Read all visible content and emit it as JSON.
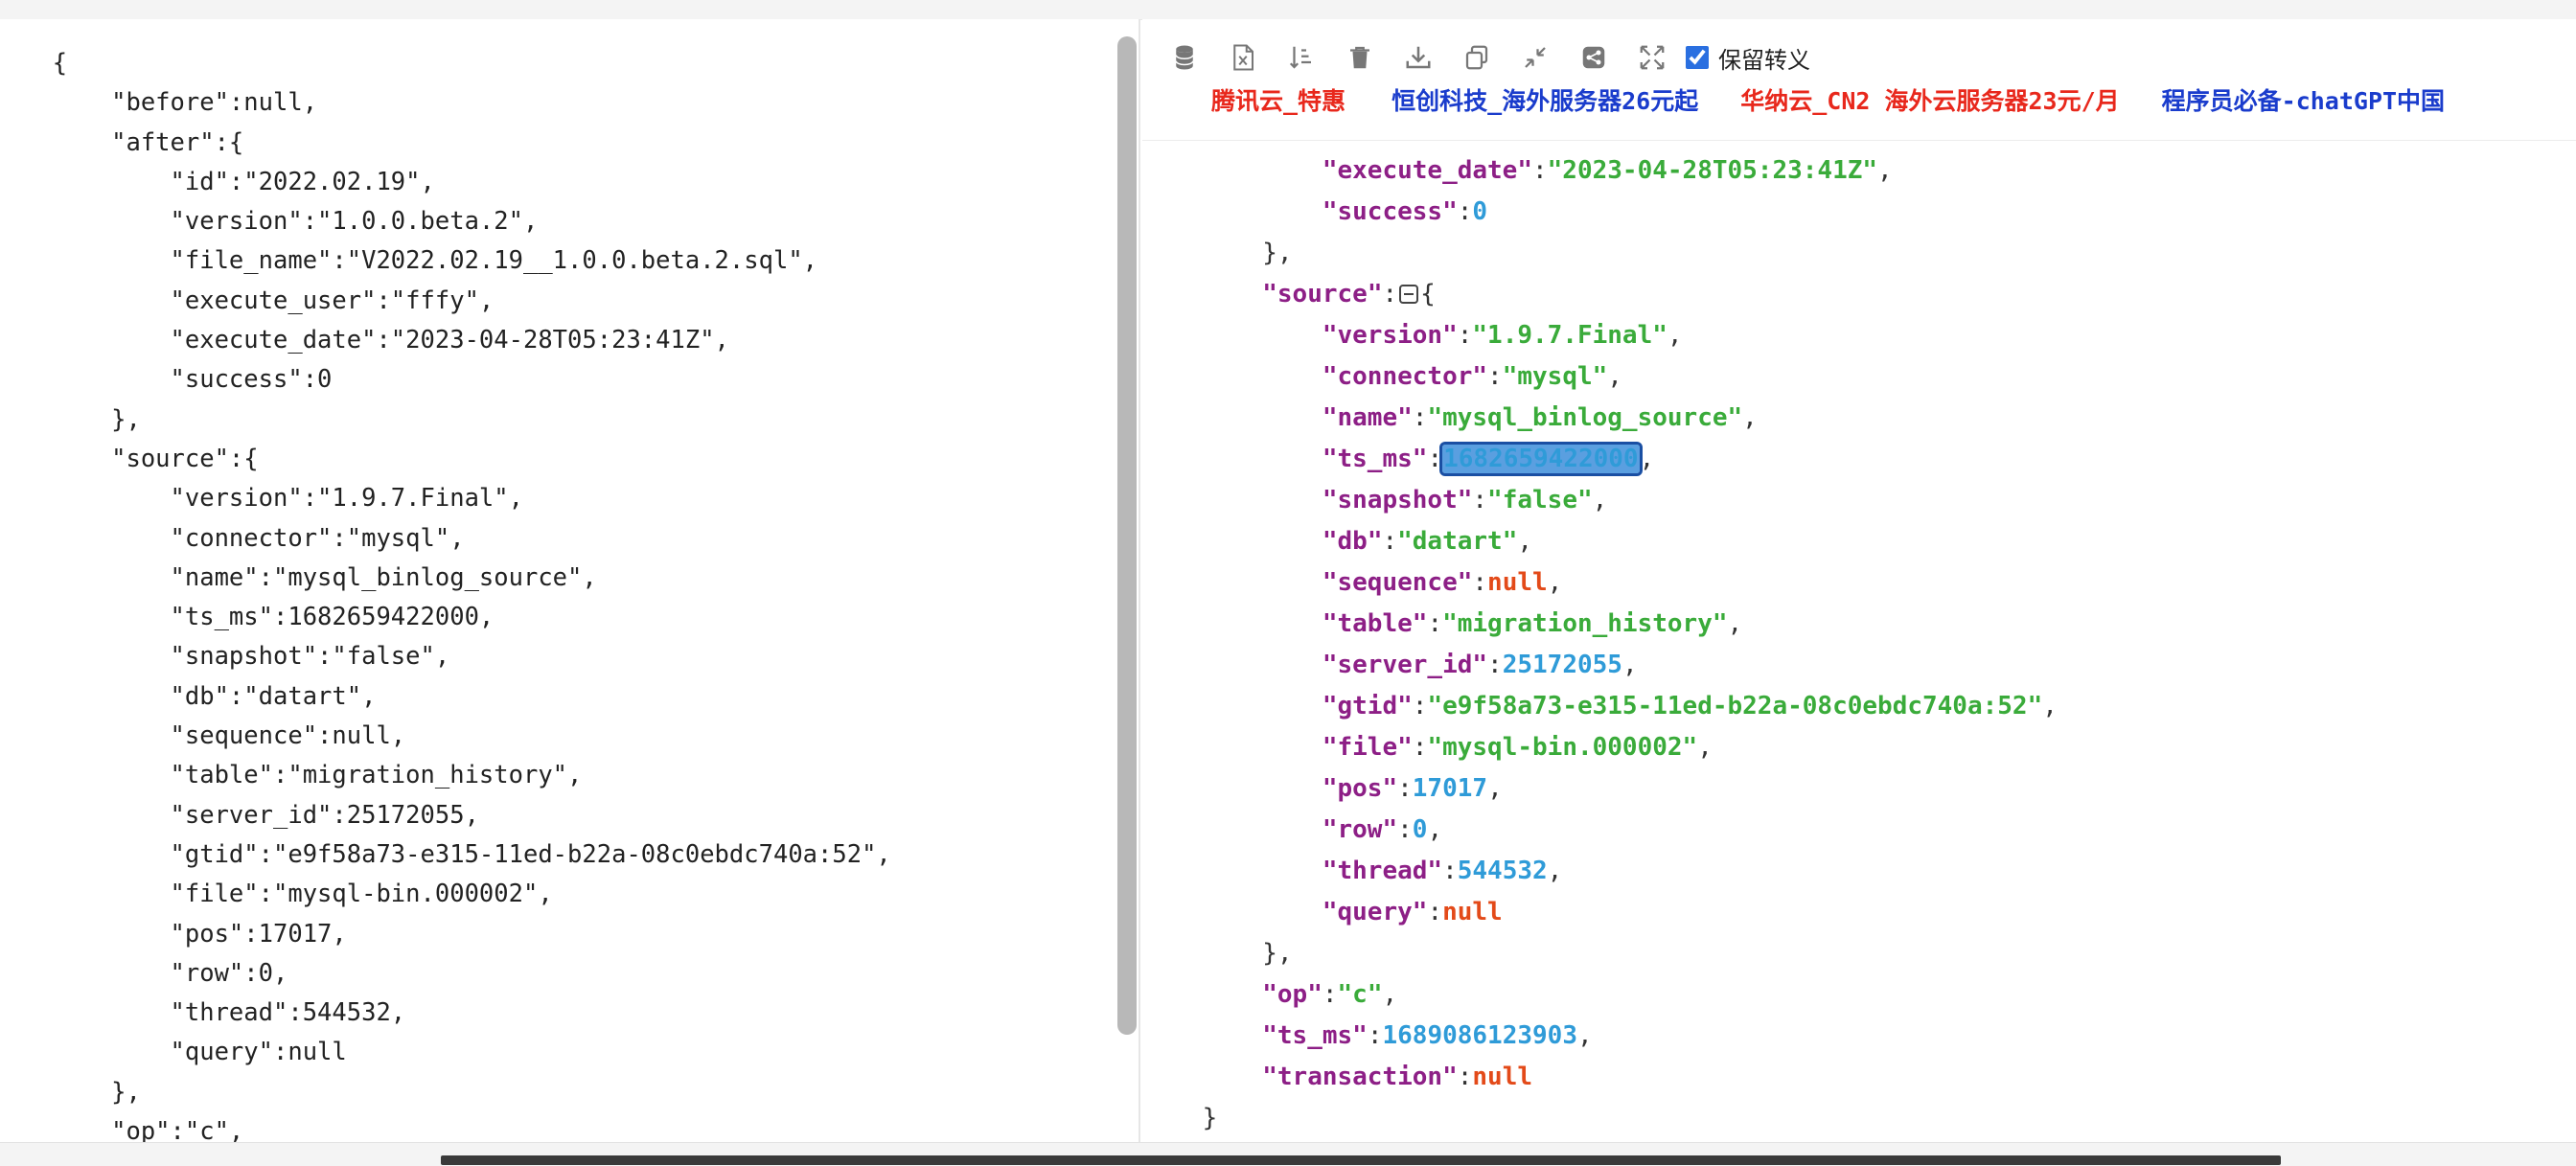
{
  "left_json_lines": [
    "  {",
    "      \"before\":null,",
    "      \"after\":{",
    "          \"id\":\"2022.02.19\",",
    "          \"version\":\"1.0.0.beta.2\",",
    "          \"file_name\":\"V2022.02.19__1.0.0.beta.2.sql\",",
    "          \"execute_user\":\"fffy\",",
    "          \"execute_date\":\"2023-04-28T05:23:41Z\",",
    "          \"success\":0",
    "      },",
    "      \"source\":{",
    "          \"version\":\"1.9.7.Final\",",
    "          \"connector\":\"mysql\",",
    "          \"name\":\"mysql_binlog_source\",",
    "          \"ts_ms\":1682659422000,",
    "          \"snapshot\":\"false\",",
    "          \"db\":\"datart\",",
    "          \"sequence\":null,",
    "          \"table\":\"migration_history\",",
    "          \"server_id\":25172055,",
    "          \"gtid\":\"e9f58a73-e315-11ed-b22a-08c0ebdc740a:52\",",
    "          \"file\":\"mysql-bin.000002\",",
    "          \"pos\":17017,",
    "          \"row\":0,",
    "          \"thread\":544532,",
    "          \"query\":null",
    "      },",
    "      \"op\":\"c\","
  ],
  "toolbar": {
    "icons": [
      "database-icon",
      "excel-export-icon",
      "sort-icon",
      "trash-icon",
      "download-icon",
      "copy-icon",
      "collapse-arrows-icon",
      "share-icon",
      "expand-arrows-icon"
    ],
    "checkbox_label": "保留转义",
    "checkbox_checked": true
  },
  "ads": [
    {
      "text": "腾讯云_特惠",
      "color": "#e8281c"
    },
    {
      "text": "恒创科技_海外服务器26元起",
      "color": "#1a3ccc"
    },
    {
      "text": "华纳云_CN2 海外云服务器23元/月",
      "color": "#e8281c"
    },
    {
      "text": "程序员必备-chatGPT中国",
      "color": "#1a3ccc"
    }
  ],
  "right_json": [
    {
      "indent": 3,
      "key": "execute_date",
      "type": "string",
      "value": "\"2023-04-28T05:23:41Z\"",
      "comma": true
    },
    {
      "indent": 3,
      "key": "success",
      "type": "number",
      "value": "0",
      "comma": false
    },
    {
      "indent": 2,
      "close": "}",
      "comma": true
    },
    {
      "indent": 2,
      "key": "source",
      "type": "object_open"
    },
    {
      "indent": 3,
      "key": "version",
      "type": "string",
      "value": "\"1.9.7.Final\"",
      "comma": true
    },
    {
      "indent": 3,
      "key": "connector",
      "type": "string",
      "value": "\"mysql\"",
      "comma": true
    },
    {
      "indent": 3,
      "key": "name",
      "type": "string",
      "value": "\"mysql_binlog_source\"",
      "comma": true
    },
    {
      "indent": 3,
      "key": "ts_ms",
      "type": "number",
      "value": "1682659422000",
      "comma": true,
      "selected": true
    },
    {
      "indent": 3,
      "key": "snapshot",
      "type": "string",
      "value": "\"false\"",
      "comma": true
    },
    {
      "indent": 3,
      "key": "db",
      "type": "string",
      "value": "\"datart\"",
      "comma": true
    },
    {
      "indent": 3,
      "key": "sequence",
      "type": "null",
      "value": "null",
      "comma": true
    },
    {
      "indent": 3,
      "key": "table",
      "type": "string",
      "value": "\"migration_history\"",
      "comma": true
    },
    {
      "indent": 3,
      "key": "server_id",
      "type": "number",
      "value": "25172055",
      "comma": true
    },
    {
      "indent": 3,
      "key": "gtid",
      "type": "string",
      "value": "\"e9f58a73-e315-11ed-b22a-08c0ebdc740a:52\"",
      "comma": true
    },
    {
      "indent": 3,
      "key": "file",
      "type": "string",
      "value": "\"mysql-bin.000002\"",
      "comma": true
    },
    {
      "indent": 3,
      "key": "pos",
      "type": "number",
      "value": "17017",
      "comma": true
    },
    {
      "indent": 3,
      "key": "row",
      "type": "number",
      "value": "0",
      "comma": true
    },
    {
      "indent": 3,
      "key": "thread",
      "type": "number",
      "value": "544532",
      "comma": true
    },
    {
      "indent": 3,
      "key": "query",
      "type": "null",
      "value": "null",
      "comma": false
    },
    {
      "indent": 2,
      "close": "}",
      "comma": true
    },
    {
      "indent": 2,
      "key": "op",
      "type": "string",
      "value": "\"c\"",
      "comma": true
    },
    {
      "indent": 2,
      "key": "ts_ms",
      "type": "number",
      "value": "1689086123903",
      "comma": true
    },
    {
      "indent": 2,
      "key": "transaction",
      "type": "null",
      "value": "null",
      "comma": false
    },
    {
      "indent": 1,
      "close": "}",
      "comma": false
    }
  ],
  "colors": {
    "key": "#8d1f86",
    "string": "#3aab3a",
    "number": "#2f9bd8",
    "null": "#e34a19",
    "ad_red": "#e8281c",
    "ad_blue": "#1a3ccc",
    "selection": "#5a9fe0"
  }
}
